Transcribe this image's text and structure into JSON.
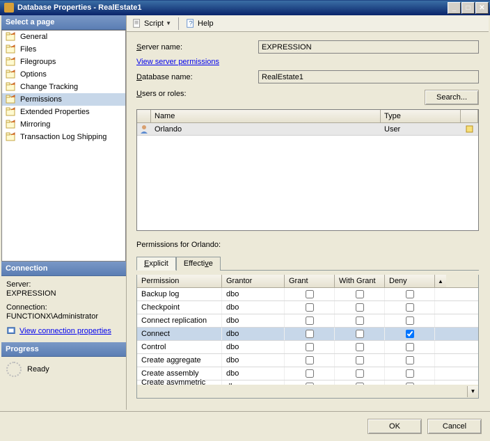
{
  "title": "Database Properties - RealEstate1",
  "sidebar": {
    "head": "Select a page",
    "items": [
      {
        "label": "General"
      },
      {
        "label": "Files"
      },
      {
        "label": "Filegroups"
      },
      {
        "label": "Options"
      },
      {
        "label": "Change Tracking"
      },
      {
        "label": "Permissions",
        "selected": true
      },
      {
        "label": "Extended Properties"
      },
      {
        "label": "Mirroring"
      },
      {
        "label": "Transaction Log Shipping"
      }
    ]
  },
  "connection": {
    "head": "Connection",
    "server_label": "Server:",
    "server_name": "EXPRESSION",
    "conn_label": "Connection:",
    "conn_name": "FUNCTIONX\\Administrator",
    "link": "View connection properties"
  },
  "progress": {
    "head": "Progress",
    "status": "Ready"
  },
  "toolbar": {
    "script": "Script",
    "help": "Help"
  },
  "form": {
    "server_label": "Server name:",
    "server_value": "EXPRESSION",
    "view_link": "View server permissions",
    "db_label": "Database name:",
    "db_value": "RealEstate1",
    "users_label": "Users or roles:",
    "search": "Search..."
  },
  "user_grid": {
    "col_name": "Name",
    "col_type": "Type",
    "rows": [
      {
        "name": "Orlando",
        "type": "User"
      }
    ]
  },
  "perms": {
    "for_label": "Permissions for Orlando:",
    "tabs": {
      "explicit": "Explicit",
      "effective": "Effective"
    },
    "cols": {
      "permission": "Permission",
      "grantor": "Grantor",
      "grant": "Grant",
      "with": "With Grant",
      "deny": "Deny"
    },
    "rows": [
      {
        "permission": "Backup log",
        "grantor": "dbo",
        "grant": false,
        "with": false,
        "deny": false,
        "sel": false
      },
      {
        "permission": "Checkpoint",
        "grantor": "dbo",
        "grant": false,
        "with": false,
        "deny": false,
        "sel": false
      },
      {
        "permission": "Connect replication",
        "grantor": "dbo",
        "grant": false,
        "with": false,
        "deny": false,
        "sel": false
      },
      {
        "permission": "Connect",
        "grantor": "dbo",
        "grant": false,
        "with": false,
        "deny": true,
        "sel": true
      },
      {
        "permission": "Control",
        "grantor": "dbo",
        "grant": false,
        "with": false,
        "deny": false,
        "sel": false
      },
      {
        "permission": "Create aggregate",
        "grantor": "dbo",
        "grant": false,
        "with": false,
        "deny": false,
        "sel": false
      },
      {
        "permission": "Create assembly",
        "grantor": "dbo",
        "grant": false,
        "with": false,
        "deny": false,
        "sel": false
      },
      {
        "permission": "Create asymmetric k...",
        "grantor": "dbo",
        "grant": false,
        "with": false,
        "deny": false,
        "sel": false
      }
    ]
  },
  "buttons": {
    "ok": "OK",
    "cancel": "Cancel"
  }
}
